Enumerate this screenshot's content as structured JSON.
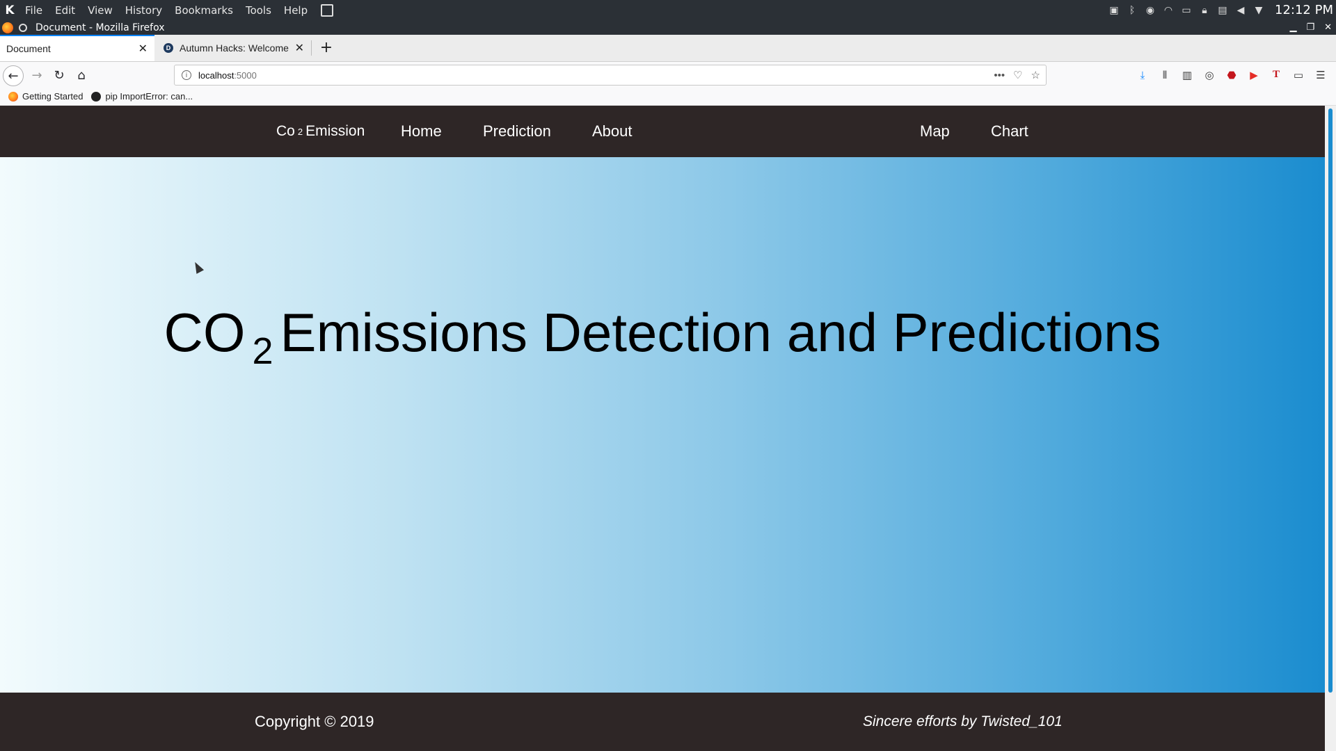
{
  "os": {
    "logo": "K",
    "menu": [
      "File",
      "Edit",
      "View",
      "History",
      "Bookmarks",
      "Tools",
      "Help"
    ],
    "clock": "12:12 PM"
  },
  "window": {
    "title": "Document - Mozilla Firefox"
  },
  "tabs": [
    {
      "label": "Document",
      "active": true
    },
    {
      "label": "Autumn Hacks: Welcome t",
      "active": false,
      "favicon": "D"
    }
  ],
  "nav": {
    "url_host": "localhost",
    "url_port": ":5000"
  },
  "bookmarks": [
    {
      "label": "Getting Started",
      "icon": "firefox-icon"
    },
    {
      "label": "pip ImportError: can...",
      "icon": "github-icon"
    }
  ],
  "site": {
    "brand_prefix": "Co",
    "brand_sub": "2",
    "brand_suffix": "Emission",
    "nav": {
      "home": "Home",
      "prediction": "Prediction",
      "about": "About",
      "map": "Map",
      "chart": "Chart"
    },
    "hero": {
      "title_prefix": "CO",
      "title_sub": "2",
      "title_suffix": "Emissions Detection and Predictions"
    },
    "footer": {
      "copyright": "Copyright © 2019",
      "credit": "Sincere efforts by Twisted_101"
    }
  },
  "colors": {
    "nav_bg": "#2e2626",
    "gradient_start": "#f2fbfd",
    "gradient_end": "#1a8ccf",
    "tab_accent": "#0a84ff"
  }
}
